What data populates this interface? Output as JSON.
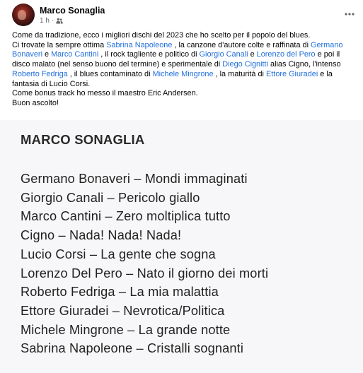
{
  "post": {
    "author": "Marco Sonaglia",
    "timestamp": "1 h",
    "meta_separator": "·",
    "icons": {
      "more": "more-dots-icon",
      "audience": "friends-audience-icon"
    },
    "text": {
      "l1": "Come da tradizione, ecco i migliori dischi del 2023 che ho scelto per il popolo del blues.",
      "l2_a": "Ci trovate la sempre ottima ",
      "l2_m1": "Sabrina Napoleone",
      "l2_b": " , la canzone d'autore colte e raffinata di ",
      "l2_m2": "Germano",
      "l3_m1": "Bonaveri",
      "l3_a": " e ",
      "l3_m2": "Marco Cantini",
      "l3_b": " , il rock tagliente e politico di ",
      "l3_m3": "Giorgio Canali",
      "l3_c": " e ",
      "l3_m4": "Lorenzo del Pero",
      "l3_d": "  e poi il",
      "l4_a": "disco malato (nel senso buono del termine) e sperimentale di ",
      "l4_m1": "Diego Cignitti",
      "l4_b": " alias Cigno, l'intenso",
      "l5_m1": "Roberto Fedriga",
      "l5_a": " , il blues contaminato di ",
      "l5_m2": "Michele Mingrone",
      "l5_b": " , la maturità di ",
      "l5_m3": "Ettore Giuradei",
      "l5_c": "  e la",
      "l6": "fantasia di Lucio Corsi.",
      "l7": "Come bonus track ho messo il maestro Eric Andersen.",
      "l8": "Buon ascolto!"
    }
  },
  "image": {
    "title": "MARCO SONAGLIA",
    "albums": [
      "Germano Bonaveri – Mondi immaginati",
      "Giorgio Canali – Pericolo giallo",
      "Marco Cantini – Zero moltiplica tutto",
      "Cigno – Nada! Nada! Nada!",
      "Lucio Corsi – La gente che sogna",
      "Lorenzo Del Pero – Nato il giorno dei morti",
      "Roberto Fedriga – La mia malattia",
      "Ettore Giuradei – Nevrotica/Politica",
      "Michele Mingrone – La grande notte",
      "Sabrina Napoleone – Cristalli sognanti"
    ]
  },
  "colors": {
    "mention": "#216fdb",
    "meta": "#65676b",
    "text": "#050505"
  }
}
